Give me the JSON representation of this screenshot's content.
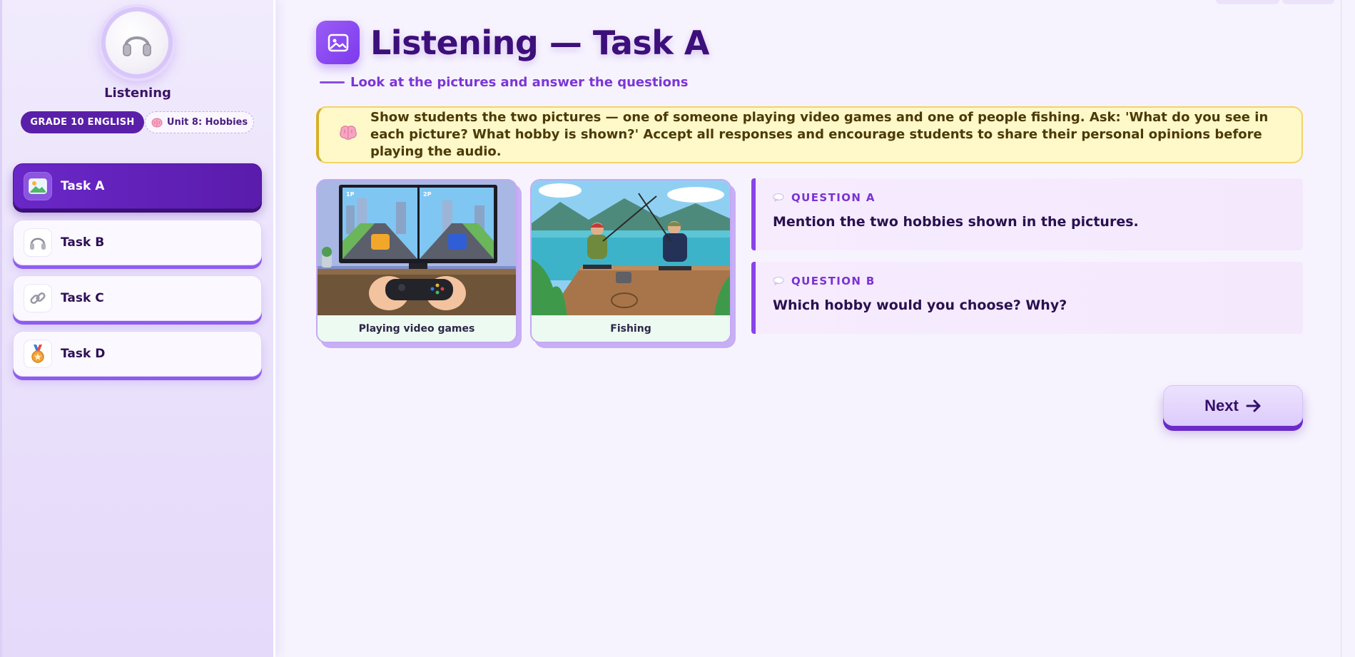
{
  "sidebar": {
    "title": "Listening",
    "avatar_icon": "headphones-icon",
    "grade_label": "GRADE 10 ENGLISH",
    "unit_label": "Unit 8: Hobbies",
    "unit_icon": "brain-icon",
    "tasks": [
      {
        "label": "Task A",
        "icon": "picture-icon",
        "active": true
      },
      {
        "label": "Task B",
        "icon": "headphones-icon",
        "active": false
      },
      {
        "label": "Task C",
        "icon": "link-icon",
        "active": false
      },
      {
        "label": "Task D",
        "icon": "medal-icon",
        "active": false
      }
    ]
  },
  "main": {
    "title": "Listening — Task A",
    "title_icon": "picture-icon",
    "subtitle": "Look at the pictures and answer the questions",
    "note": {
      "icon": "brain-icon",
      "text": "Show students the two pictures — one of someone playing video games and one of people fishing. Ask: 'What do you see in each picture? What hobby is shown?' Accept all responses and encourage students to share their personal opinions before playing the audio."
    },
    "pictures": [
      {
        "caption": "Playing video games",
        "screen_labels": [
          "1P",
          "2P"
        ]
      },
      {
        "caption": "Fishing"
      }
    ],
    "questions": [
      {
        "label": "QUESTION A",
        "text": "Mention the two hobbies shown in the pictures.",
        "icon": "speech-bubble-icon"
      },
      {
        "label": "QUESTION B",
        "text": "Which hobby would you choose? Why?",
        "icon": "speech-bubble-icon"
      }
    ],
    "next_label": "Next",
    "next_icon": "arrow-right-icon"
  },
  "colors": {
    "accent": "#7c3aed",
    "accent_dark": "#5a1fa8",
    "note_bg": "#fff8c9",
    "question_bg": "#f6ecfe",
    "caption_bg": "#ecfaf1"
  }
}
